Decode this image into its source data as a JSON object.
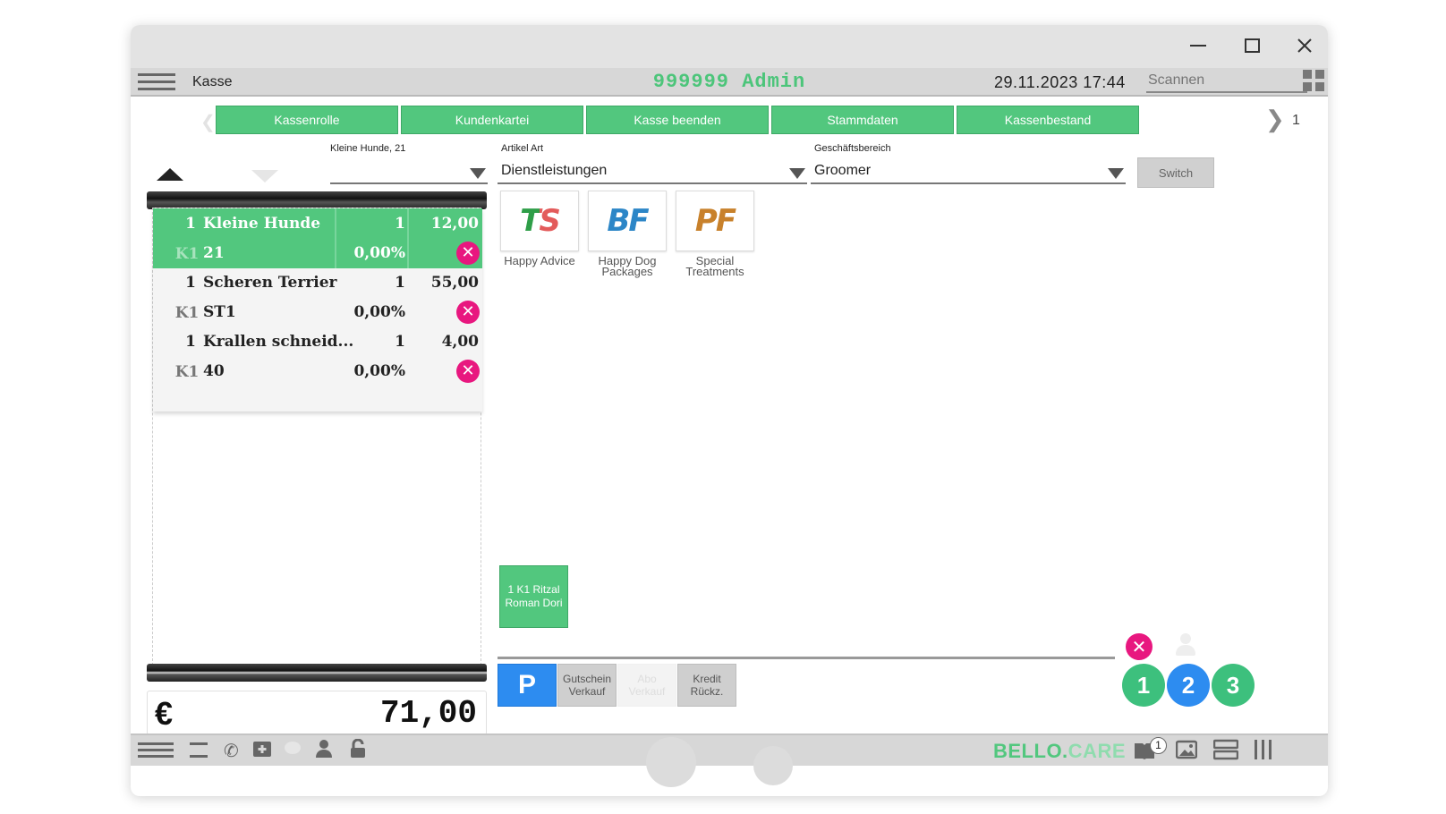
{
  "header": {
    "app_title": "Kasse",
    "user_title": "999999 Admin",
    "datetime": "29.11.2023 17:44",
    "scan_placeholder": "Scannen"
  },
  "tabs": {
    "items": [
      "Kassenrolle",
      "Kundenkartei",
      "Kasse beenden",
      "Stammdaten",
      "Kassenbestand"
    ],
    "page": "1"
  },
  "filters": {
    "cart_select_label": "Kleine Hunde, 21",
    "cart_select_value": "",
    "article_label": "Artikel Art",
    "article_value": "Dienstleistungen",
    "business_label": "Geschäftsbereich",
    "business_value": "Groomer",
    "switch_label": "Switch"
  },
  "cart": {
    "items": [
      {
        "qty": "1",
        "name": "Kleine Hunde",
        "amount": "1",
        "price": "12,00",
        "kst": "K1",
        "code": "21",
        "discount": "0,00%"
      },
      {
        "qty": "1",
        "name": "Scheren Terrier",
        "amount": "1",
        "price": "55,00",
        "kst": "K1",
        "code": "ST1",
        "discount": "0,00%"
      },
      {
        "qty": "1",
        "name": "Krallen schneid...",
        "amount": "1",
        "price": "4,00",
        "kst": "K1",
        "code": "40",
        "discount": "0,00%"
      }
    ],
    "remove_symbol": "✕",
    "currency": "€",
    "total": "71,00"
  },
  "products": [
    {
      "abbr": "TS",
      "label": "Happy Advice",
      "color1": "#2e9e48",
      "color2": "#e35b5b"
    },
    {
      "abbr": "BF",
      "label": "Happy Dog Packages",
      "color1": "#2c86c7",
      "color2": "#2c86c7"
    },
    {
      "abbr": "PF",
      "label": "Special Treatments",
      "color1": "#c8812b",
      "color2": "#c8812b"
    }
  ],
  "customer_tile": "1 K1 Ritzal Roman Dori",
  "payment": {
    "p_label": "P",
    "voucher_label": "Gutschein Verkauf",
    "faded_label": "Abo Verkauf",
    "credit_label": "Kredit Rückz."
  },
  "numpad": {
    "clear_symbol": "✕",
    "buttons": [
      "1",
      "2",
      "3"
    ]
  },
  "footer": {
    "brand_a": "BELLO.",
    "brand_b": "CARE",
    "badge": "1"
  },
  "colors": {
    "accent": "#52c77e",
    "blue": "#2d8cf0",
    "remove": "#e8177f"
  }
}
